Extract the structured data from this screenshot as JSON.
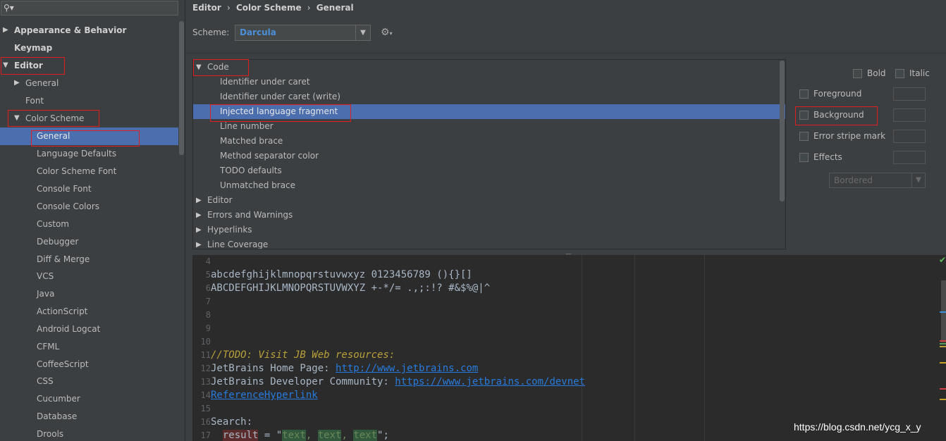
{
  "search": {
    "icon": "search-icon",
    "placeholder": ""
  },
  "sidebar": {
    "appearance": "Appearance & Behavior",
    "keymap": "Keymap",
    "editor": "Editor",
    "general": "General",
    "font": "Font",
    "color_scheme": "Color Scheme",
    "cs_items": [
      "General",
      "Language Defaults",
      "Color Scheme Font",
      "Console Font",
      "Console Colors",
      "Custom",
      "Debugger",
      "Diff & Merge",
      "VCS",
      "Java",
      "ActionScript",
      "Android Logcat",
      "CFML",
      "CoffeeScript",
      "CSS",
      "Cucumber",
      "Database",
      "Drools"
    ]
  },
  "breadcrumb": [
    "Editor",
    "›",
    "Color Scheme",
    "›",
    "General"
  ],
  "scheme": {
    "label": "Scheme:",
    "value": "Darcula"
  },
  "code_tree": {
    "code": "Code",
    "items": [
      "Identifier under caret",
      "Identifier under caret (write)",
      "Injected language fragment",
      "Line number",
      "Matched brace",
      "Method separator color",
      "TODO defaults",
      "Unmatched brace"
    ],
    "groups": [
      "Editor",
      "Errors and Warnings",
      "Hyperlinks",
      "Line Coverage"
    ]
  },
  "attributes": {
    "bold": "Bold",
    "italic": "Italic",
    "foreground": "Foreground",
    "background": "Background",
    "error_stripe": "Error stripe mark",
    "effects": "Effects",
    "effect_type": "Bordered"
  },
  "preview": {
    "l4": "4",
    "l5n": "5",
    "l5": "abcdefghijklmnopqrstuvwxyz 0123456789 (){}[]",
    "l6n": "6",
    "l6": "ABCDEFGHIJKLMNOPQRSTUVWXYZ +-*/= .,;:!? #&$%@|^",
    "l7": "7",
    "l8": "8",
    "l9": "9",
    "l10": "10",
    "l11n": "11",
    "l11": "//TODO: Visit JB Web resources:",
    "l12n": "12",
    "l12a": "JetBrains Home Page: ",
    "l12b": "http://www.jetbrains.com",
    "l13n": "13",
    "l13a": "JetBrains Developer Community: ",
    "l13b": "https://www.jetbrains.com/devnet",
    "l14n": "14",
    "l14": "ReferenceHyperlink",
    "l15": "15",
    "l16n": "16",
    "l16": "Search:",
    "l17n": "17",
    "l17a": "result",
    "l17b": " = \"",
    "l17c": "text",
    "l17d": ", ",
    "l17e": "text",
    "l17f": ", ",
    "l17g": "text",
    "l17h": "\";"
  },
  "watermark": "https://blog.csdn.net/ycg_x_y",
  "colors": {
    "selection": "#4b6eaf",
    "highlight_box": "#e02020",
    "link": "#287bde"
  }
}
